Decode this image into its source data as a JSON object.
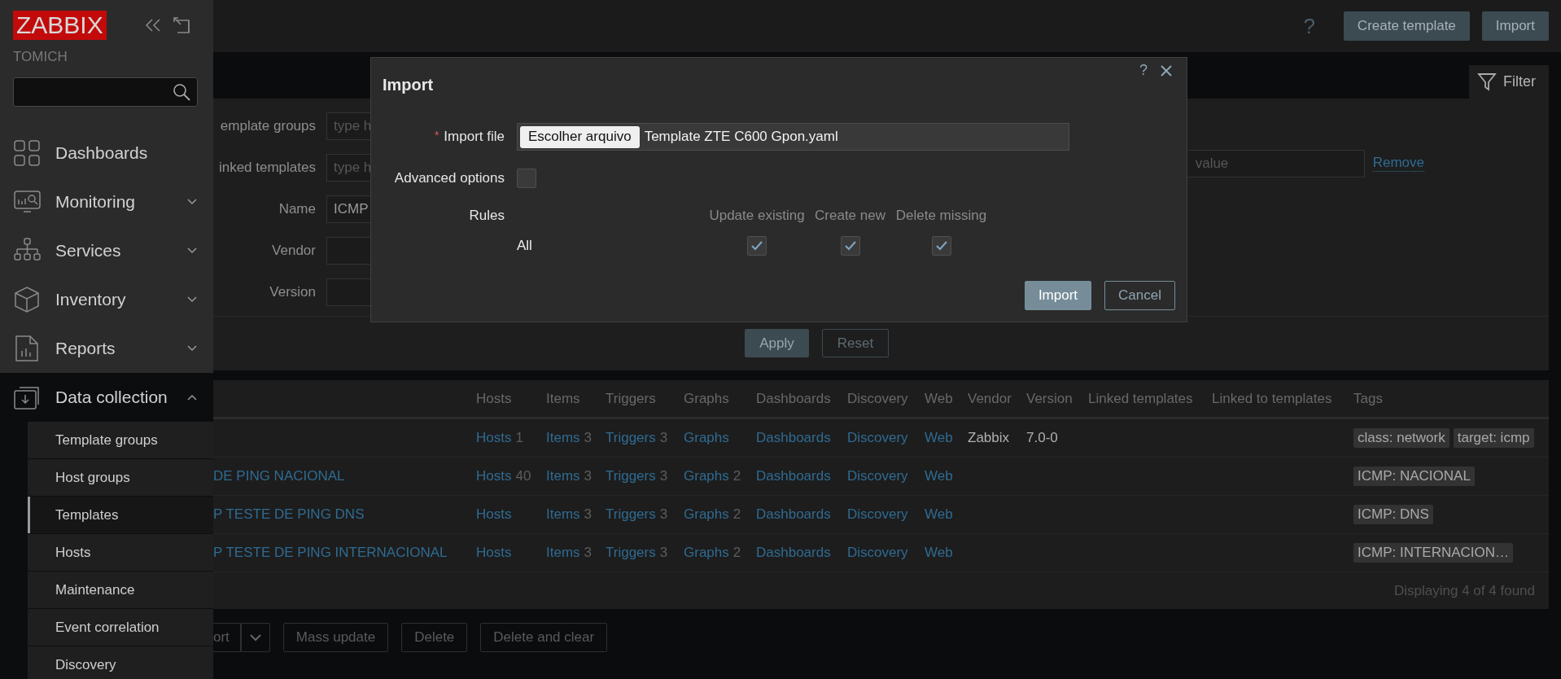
{
  "sidebar": {
    "logo": "ZABBIX",
    "server_name": "TOMICH",
    "menu": [
      {
        "label": "Dashboards",
        "kind": "link",
        "expanded": false
      },
      {
        "label": "Monitoring",
        "kind": "group",
        "expanded": false
      },
      {
        "label": "Services",
        "kind": "group",
        "expanded": false
      },
      {
        "label": "Inventory",
        "kind": "group",
        "expanded": false
      },
      {
        "label": "Reports",
        "kind": "group",
        "expanded": false
      },
      {
        "label": "Data collection",
        "kind": "group",
        "expanded": true,
        "children": [
          {
            "label": "Template groups",
            "selected": false
          },
          {
            "label": "Host groups",
            "selected": false
          },
          {
            "label": "Templates",
            "selected": true
          },
          {
            "label": "Hosts",
            "selected": false
          },
          {
            "label": "Maintenance",
            "selected": false
          },
          {
            "label": "Event correlation",
            "selected": false
          },
          {
            "label": "Discovery",
            "selected": false
          }
        ]
      }
    ]
  },
  "header": {
    "help": "?",
    "buttons": [
      "Create template",
      "Import"
    ]
  },
  "filter": {
    "tab": "Filter",
    "fields": [
      {
        "label": "emplate groups",
        "placeholder": "type h"
      },
      {
        "label": "inked templates",
        "placeholder": "type h"
      },
      {
        "label": "Name",
        "value": "ICMP"
      },
      {
        "label": "Vendor"
      },
      {
        "label": "Version"
      }
    ],
    "tag_value_placeholder": "value",
    "remove_link": "Remove",
    "apply": "Apply",
    "reset": "Reset"
  },
  "table": {
    "columns": [
      "Hosts",
      "Items",
      "Triggers",
      "Graphs",
      "Dashboards",
      "Discovery",
      "Web",
      "Vendor",
      "Version",
      "Linked templates",
      "Linked to templates",
      "Tags"
    ],
    "rows": [
      {
        "hosts": {
          "label": "Hosts",
          "count": "1"
        },
        "items": {
          "label": "Items",
          "count": "3"
        },
        "triggers": {
          "label": "Triggers",
          "count": "3"
        },
        "graphs": {
          "label": "Graphs"
        },
        "dashboards": "Dashboards",
        "discovery": "Discovery",
        "web": "Web",
        "vendor": "Zabbix",
        "version": "7.0-0",
        "tags": [
          "class: network",
          "target: icmp"
        ]
      },
      {
        "name": "DE PING NACIONAL",
        "hosts": {
          "label": "Hosts",
          "count": "40"
        },
        "items": {
          "label": "Items",
          "count": "3"
        },
        "triggers": {
          "label": "Triggers",
          "count": "3"
        },
        "graphs": {
          "label": "Graphs",
          "count": "2"
        },
        "dashboards": "Dashboards",
        "discovery": "Discovery",
        "web": "Web",
        "tags": [
          "ICMP: NACIONAL"
        ]
      },
      {
        "name": "P TESTE DE PING DNS",
        "hosts": {
          "label": "Hosts"
        },
        "items": {
          "label": "Items",
          "count": "3"
        },
        "triggers": {
          "label": "Triggers",
          "count": "3"
        },
        "graphs": {
          "label": "Graphs",
          "count": "2"
        },
        "dashboards": "Dashboards",
        "discovery": "Discovery",
        "web": "Web",
        "tags": [
          "ICMP: DNS"
        ]
      },
      {
        "name": "P TESTE DE PING INTERNACIONAL",
        "hosts": {
          "label": "Hosts"
        },
        "items": {
          "label": "Items",
          "count": "3"
        },
        "triggers": {
          "label": "Triggers",
          "count": "3"
        },
        "graphs": {
          "label": "Graphs",
          "count": "2"
        },
        "dashboards": "Dashboards",
        "discovery": "Discovery",
        "web": "Web",
        "tags": [
          "ICMP: INTERNACION…"
        ]
      }
    ],
    "footer": "Displaying 4 of 4 found"
  },
  "actions": [
    "ort",
    "Mass update",
    "Delete",
    "Delete and clear"
  ],
  "dialog": {
    "title": "Import",
    "help": "?",
    "import_file": {
      "label": "Import file",
      "required_mark": "*",
      "button": "Escolher arquivo",
      "file_name": "Template ZTE C600 Gpon.yaml"
    },
    "advanced_options": {
      "label": "Advanced options",
      "checked": false
    },
    "rules": {
      "label": "Rules",
      "columns": [
        "Update existing",
        "Create new",
        "Delete missing"
      ],
      "rows": [
        {
          "label": "All",
          "checks": [
            true,
            true,
            true
          ]
        }
      ]
    },
    "buttons": [
      {
        "label": "Import",
        "kind": "primary"
      },
      {
        "label": "Cancel",
        "kind": "secondary"
      }
    ]
  }
}
